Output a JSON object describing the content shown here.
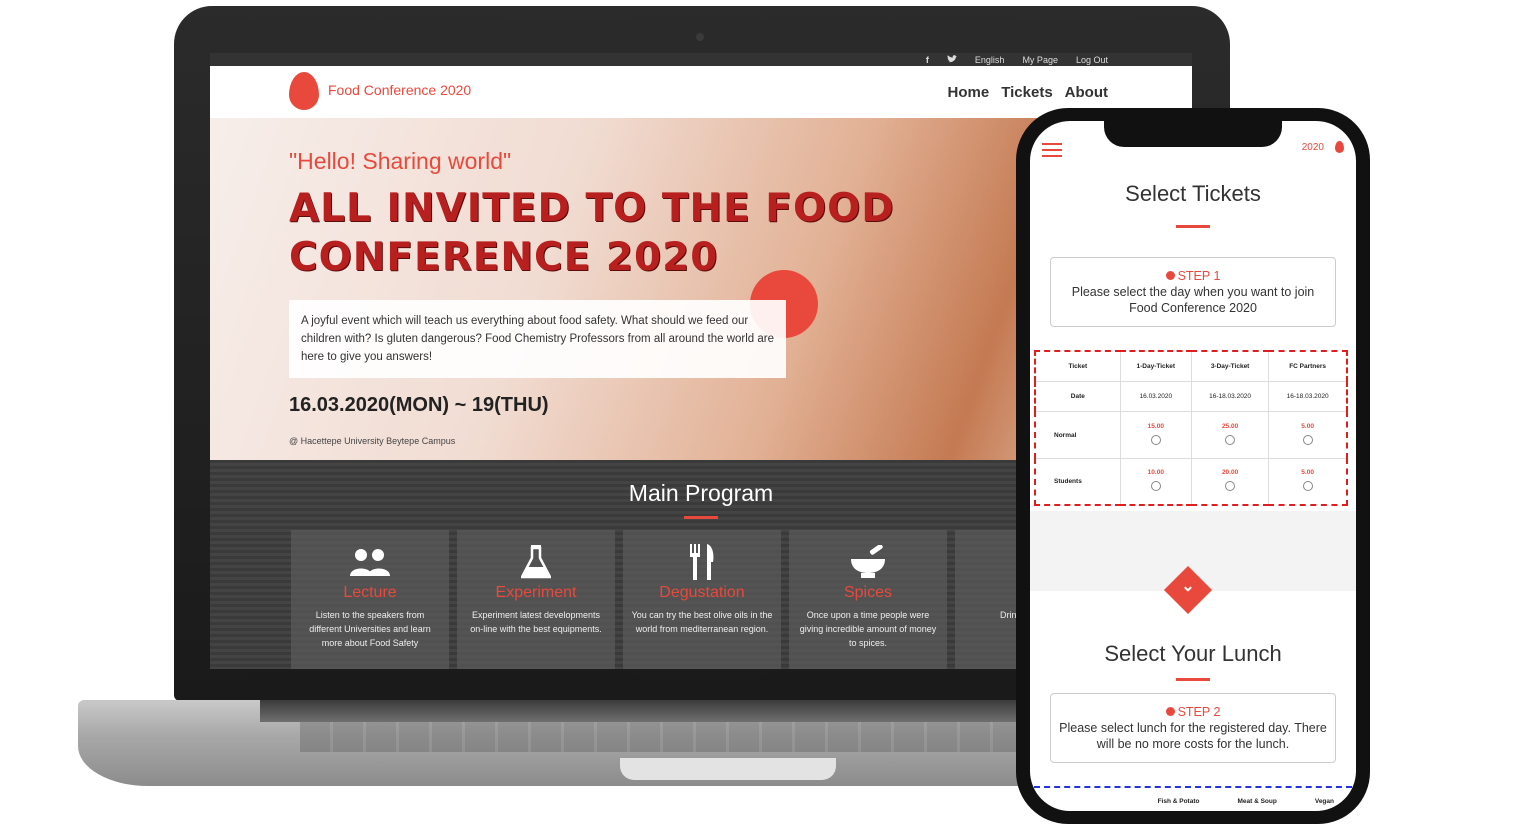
{
  "laptop": {
    "topbar": {
      "facebook_icon": "f",
      "twitter_icon": "twitter-icon",
      "language": "English",
      "my_page": "My Page",
      "log_out": "Log Out"
    },
    "brand": "Food Conference 2020",
    "nav": [
      "Home",
      "Tickets",
      "About"
    ],
    "hero": {
      "quote": "\"Hello! Sharing world\"",
      "title_line1": "ALL INVITED TO THE FOOD",
      "title_line2": "CONFERENCE 2020",
      "description": "A joyful event which will teach us everything about food safety. What should we feed our children with? Is gluten dangerous? Food Chemistry Professors from all around the world are here to give you answers!",
      "date": "16.03.2020(MON) ~ 19(THU)",
      "venue": "@ Hacettepe University Beytepe Campus"
    },
    "program": {
      "title": "Main Program",
      "cards": [
        {
          "icon": "users-icon",
          "title": "Lecture",
          "desc": "Listen to the speakers from different Universities and learn more about Food Safety"
        },
        {
          "icon": "flask-icon",
          "title": "Experiment",
          "desc": "Experiment latest developments on-line with the best equipments."
        },
        {
          "icon": "utensils-icon",
          "title": "Degustation",
          "desc": "You can try the best olive oils in the world from mediterranean region."
        },
        {
          "icon": "mortar-icon",
          "title": "Spices",
          "desc": "Once upon a time people were giving incredible amount of money to spices."
        },
        {
          "icon": "cup-icon",
          "title": "C",
          "desc": "Drink, talk free of"
        }
      ]
    }
  },
  "phone": {
    "year": "2020",
    "select_tickets": "Select Tickets",
    "step1": {
      "label": "STEP 1",
      "text": "Please select the day when you want to join Food Conference 2020"
    },
    "ticket_table": {
      "headers": [
        "Ticket",
        "1-Day-Ticket",
        "3-Day-Ticket",
        "FC Partners"
      ],
      "date_label": "Date",
      "dates": [
        "16.03.2020",
        "16-18.03.2020",
        "16-18.03.2020"
      ],
      "rows": [
        {
          "label": "Normal",
          "prices": [
            "15.00",
            "25.00",
            "5.00"
          ]
        },
        {
          "label": "Students",
          "prices": [
            "10.00",
            "20.00",
            "5.00"
          ]
        }
      ]
    },
    "select_lunch": "Select Your Lunch",
    "step2": {
      "label": "STEP 2",
      "text": "Please select lunch for the registered day. There will be no more costs for the lunch."
    },
    "lunch_headers": [
      "Fish & Potato",
      "Meat & Soup",
      "Vegan"
    ]
  }
}
